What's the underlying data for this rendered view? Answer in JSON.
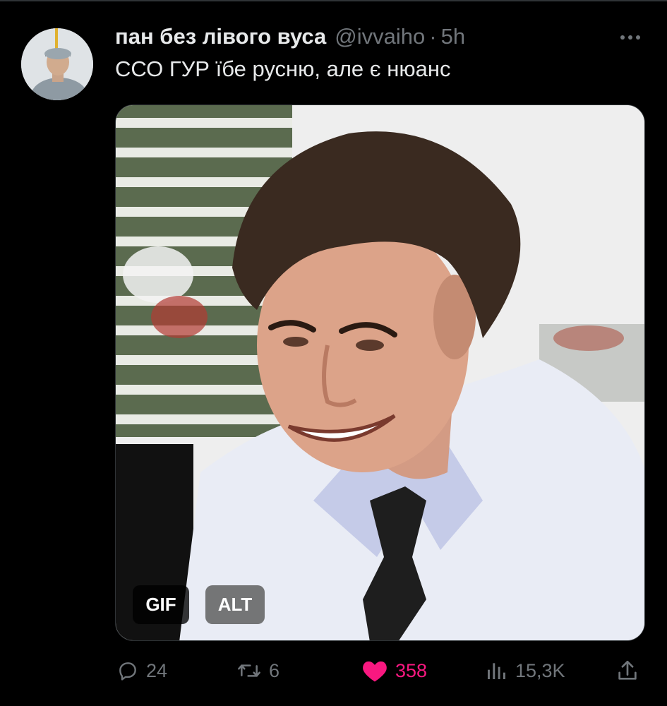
{
  "tweet": {
    "display_name": "пан без лівого вуса",
    "handle": "@ivvaiho",
    "separator": "·",
    "time": "5h",
    "text": "ССО ГУР їбе русню, але є нюанс",
    "media": {
      "gif_badge": "GIF",
      "alt_badge": "ALT"
    },
    "actions": {
      "replies": "24",
      "retweets": "6",
      "likes": "358",
      "views": "15,3K"
    },
    "like_color": "#f91880",
    "icons": [
      "reply-icon",
      "retweet-icon",
      "heart-icon",
      "views-icon",
      "share-icon",
      "more-icon"
    ]
  }
}
